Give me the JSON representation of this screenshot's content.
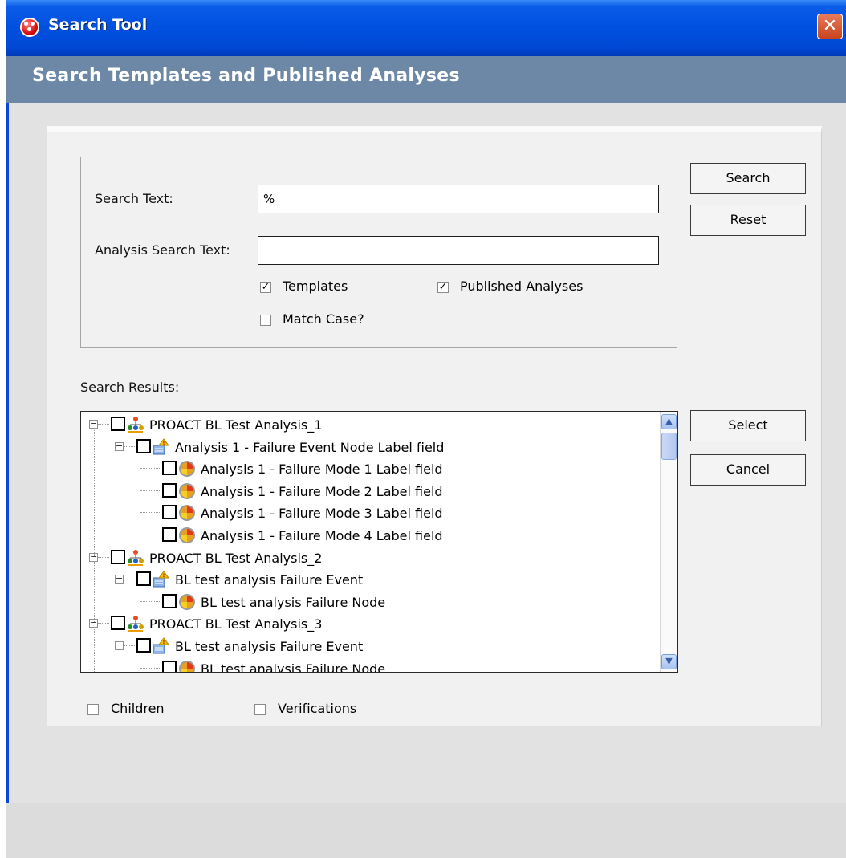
{
  "window": {
    "title": "Search Tool",
    "close_glyph": "✕"
  },
  "header": {
    "title": "Search Templates and Published Analyses"
  },
  "criteria": {
    "search_text_label": "Search Text:",
    "search_text_value": "%",
    "analysis_search_text_label": "Analysis Search Text:",
    "analysis_search_text_value": "",
    "templates_label": "Templates",
    "templates_checked": true,
    "published_label": "Published Analyses",
    "published_checked": true,
    "match_case_label": "Match Case?",
    "match_case_checked": false
  },
  "buttons": {
    "search": "Search",
    "reset": "Reset",
    "select": "Select",
    "cancel": "Cancel"
  },
  "results": {
    "label": "Search Results:",
    "items": [
      {
        "level": 0,
        "icon": "analysis-tree-icon",
        "label": "PROACT BL Test Analysis_1"
      },
      {
        "level": 1,
        "icon": "failure-event-icon",
        "label": "Analysis 1 - Failure Event Node Label field"
      },
      {
        "level": 2,
        "icon": "failure-mode-icon",
        "label": "Analysis 1 - Failure Mode 1 Label field"
      },
      {
        "level": 2,
        "icon": "failure-mode-icon",
        "label": "Analysis 1 - Failure Mode 2 Label field"
      },
      {
        "level": 2,
        "icon": "failure-mode-icon",
        "label": "Analysis 1 - Failure Mode 3 Label field"
      },
      {
        "level": 2,
        "icon": "failure-mode-icon",
        "label": "Analysis 1 - Failure Mode 4 Label field"
      },
      {
        "level": 0,
        "icon": "analysis-tree-icon",
        "label": "PROACT BL Test Analysis_2"
      },
      {
        "level": 1,
        "icon": "failure-event-icon",
        "label": "BL test analysis Failure Event"
      },
      {
        "level": 2,
        "icon": "failure-mode-icon",
        "label": "BL test analysis Failure Node"
      },
      {
        "level": 0,
        "icon": "analysis-tree-icon",
        "label": "PROACT BL Test Analysis_3"
      },
      {
        "level": 1,
        "icon": "failure-event-icon",
        "label": "BL test analysis Failure Event"
      },
      {
        "level": 2,
        "icon": "failure-mode-icon",
        "label": "BL test analysis Failure Node"
      }
    ]
  },
  "options": {
    "children_label": "Children",
    "children_checked": false,
    "verifications_label": "Verifications",
    "verifications_checked": false
  }
}
